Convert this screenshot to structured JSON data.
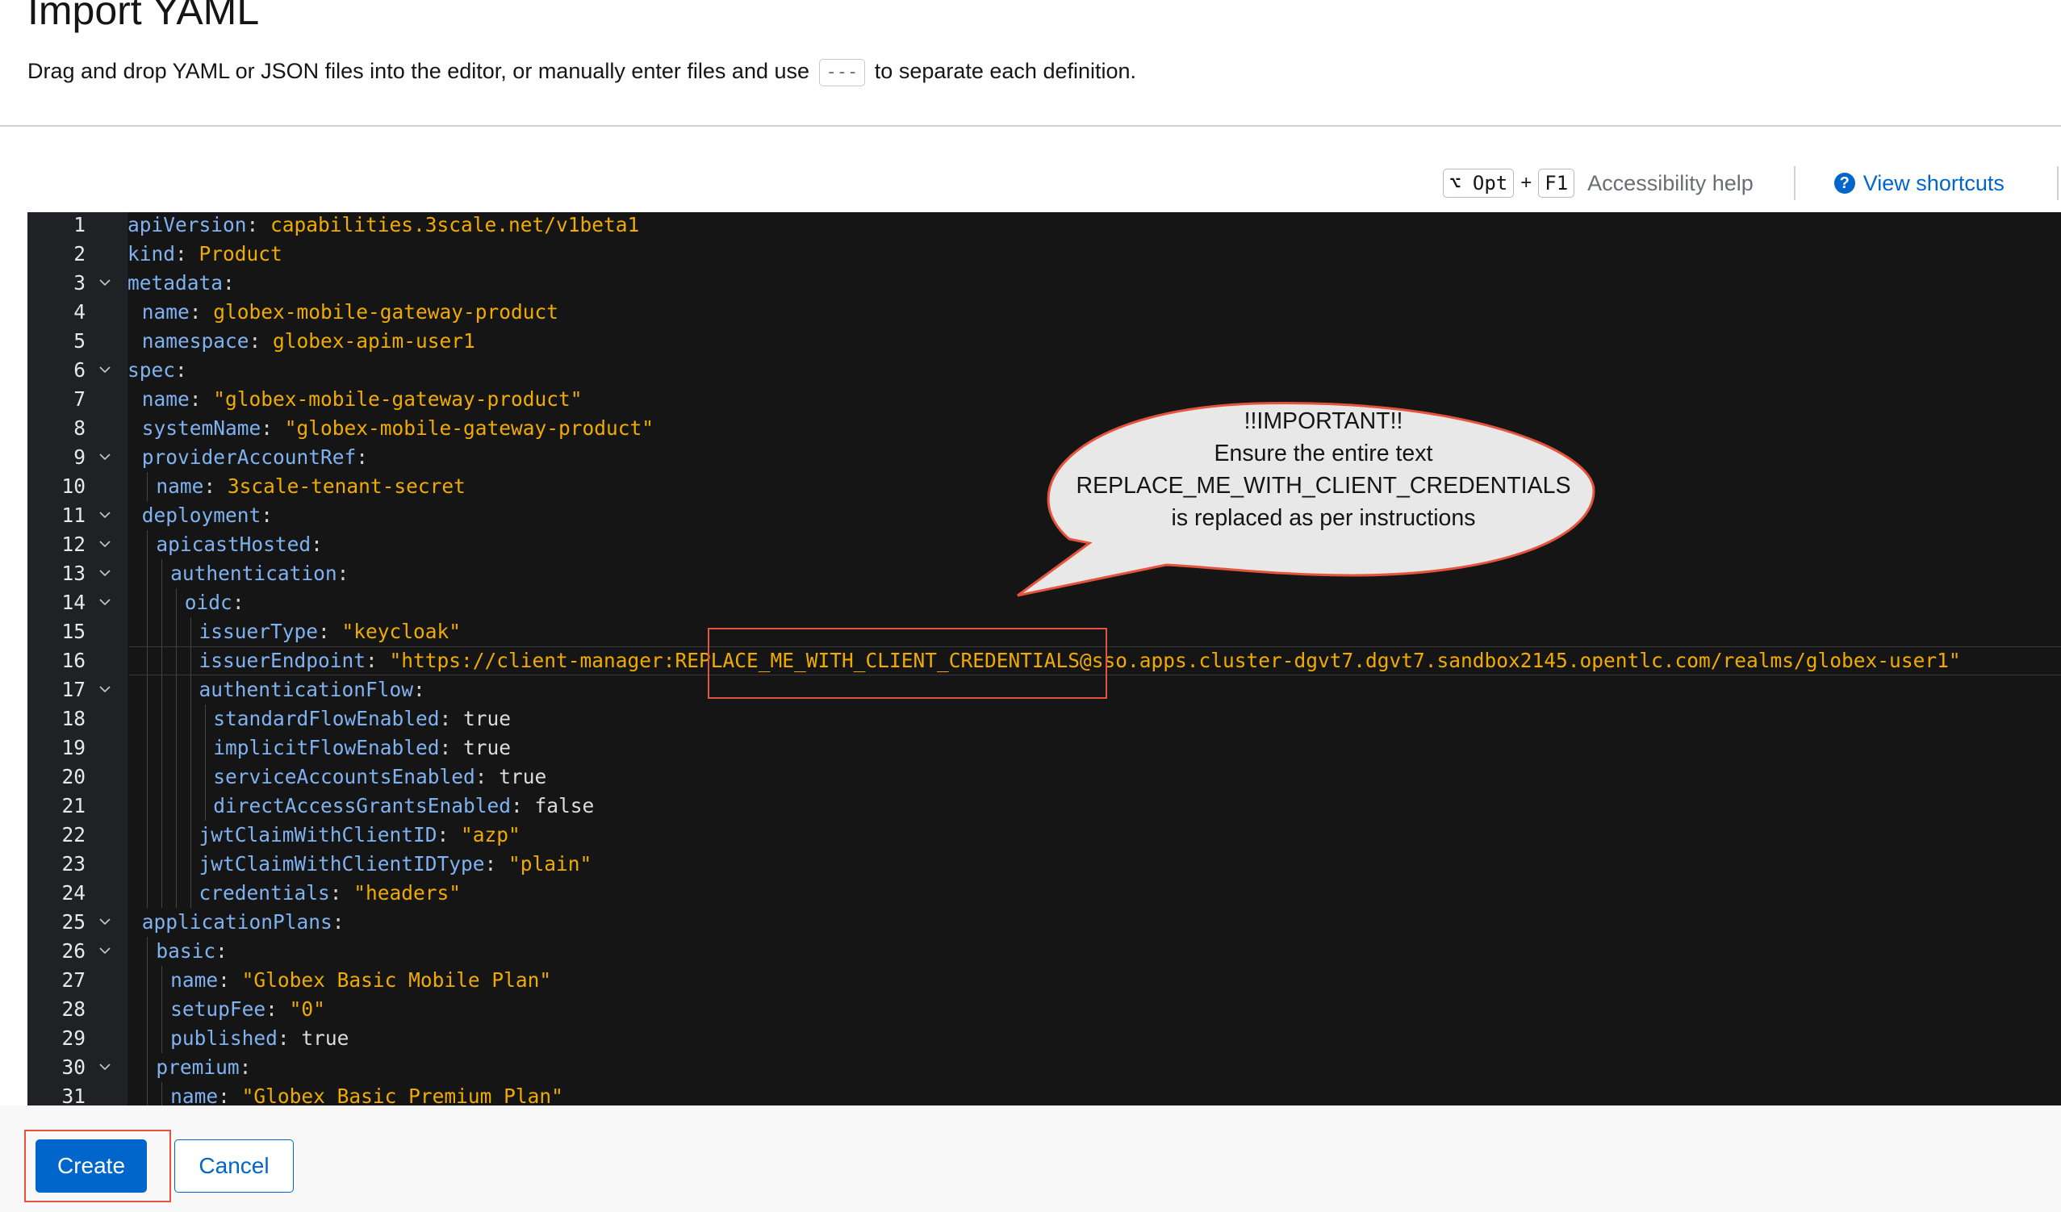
{
  "header": {
    "title": "Import YAML",
    "description_before": "Drag and drop YAML or JSON files into the editor, or manually enter files and use",
    "separator_token": "---",
    "description_after": "to separate each definition."
  },
  "toolbar": {
    "opt_key": "⌥ Opt",
    "plus": "+",
    "f1_key": "F1",
    "accessibility_help": "Accessibility help",
    "view_shortcuts": "View shortcuts",
    "help_icon": "question-circle-icon"
  },
  "editor": {
    "theme": {
      "key_color": "#7fb2f0",
      "value_color": "#f0ab00",
      "background": "#151515"
    },
    "current_line": 16,
    "lines": [
      {
        "n": 1,
        "indent": 0,
        "fold": false,
        "key": "apiVersion",
        "value": "capabilities.3scale.net/v1beta1",
        "vtype": "str"
      },
      {
        "n": 2,
        "indent": 0,
        "fold": false,
        "key": "kind",
        "value": "Product",
        "vtype": "str"
      },
      {
        "n": 3,
        "indent": 0,
        "fold": true,
        "key": "metadata",
        "value": "",
        "vtype": "none"
      },
      {
        "n": 4,
        "indent": 1,
        "fold": false,
        "key": "name",
        "value": "globex-mobile-gateway-product",
        "vtype": "str"
      },
      {
        "n": 5,
        "indent": 1,
        "fold": false,
        "key": "namespace",
        "value": "globex-apim-user1",
        "vtype": "str"
      },
      {
        "n": 6,
        "indent": 0,
        "fold": true,
        "key": "spec",
        "value": "",
        "vtype": "none"
      },
      {
        "n": 7,
        "indent": 1,
        "fold": false,
        "key": "name",
        "value": "\"globex-mobile-gateway-product\"",
        "vtype": "str"
      },
      {
        "n": 8,
        "indent": 1,
        "fold": false,
        "key": "systemName",
        "value": "\"globex-mobile-gateway-product\"",
        "vtype": "str"
      },
      {
        "n": 9,
        "indent": 1,
        "fold": true,
        "key": "providerAccountRef",
        "value": "",
        "vtype": "none"
      },
      {
        "n": 10,
        "indent": 2,
        "fold": false,
        "key": "name",
        "value": "3scale-tenant-secret",
        "vtype": "str"
      },
      {
        "n": 11,
        "indent": 1,
        "fold": true,
        "key": "deployment",
        "value": "",
        "vtype": "none"
      },
      {
        "n": 12,
        "indent": 2,
        "fold": true,
        "key": "apicastHosted",
        "value": "",
        "vtype": "none"
      },
      {
        "n": 13,
        "indent": 3,
        "fold": true,
        "key": "authentication",
        "value": "",
        "vtype": "none"
      },
      {
        "n": 14,
        "indent": 4,
        "fold": true,
        "key": "oidc",
        "value": "",
        "vtype": "none"
      },
      {
        "n": 15,
        "indent": 5,
        "fold": false,
        "key": "issuerType",
        "value": "\"keycloak\"",
        "vtype": "str"
      },
      {
        "n": 16,
        "indent": 5,
        "fold": false,
        "key": "issuerEndpoint",
        "value": "\"https://client-manager:REPLACE_ME_WITH_CLIENT_CREDENTIALS@sso.apps.cluster-dgvt7.dgvt7.sandbox2145.opentlc.com/realms/globex-user1\"",
        "vtype": "str"
      },
      {
        "n": 17,
        "indent": 5,
        "fold": true,
        "key": "authenticationFlow",
        "value": "",
        "vtype": "none"
      },
      {
        "n": 18,
        "indent": 6,
        "fold": false,
        "key": "standardFlowEnabled",
        "value": "true",
        "vtype": "bool"
      },
      {
        "n": 19,
        "indent": 6,
        "fold": false,
        "key": "implicitFlowEnabled",
        "value": "true",
        "vtype": "bool"
      },
      {
        "n": 20,
        "indent": 6,
        "fold": false,
        "key": "serviceAccountsEnabled",
        "value": "true",
        "vtype": "bool"
      },
      {
        "n": 21,
        "indent": 6,
        "fold": false,
        "key": "directAccessGrantsEnabled",
        "value": "false",
        "vtype": "bool"
      },
      {
        "n": 22,
        "indent": 5,
        "fold": false,
        "key": "jwtClaimWithClientID",
        "value": "\"azp\"",
        "vtype": "str"
      },
      {
        "n": 23,
        "indent": 5,
        "fold": false,
        "key": "jwtClaimWithClientIDType",
        "value": "\"plain\"",
        "vtype": "str"
      },
      {
        "n": 24,
        "indent": 5,
        "fold": false,
        "key": "credentials",
        "value": "\"headers\"",
        "vtype": "str"
      },
      {
        "n": 25,
        "indent": 1,
        "fold": true,
        "key": "applicationPlans",
        "value": "",
        "vtype": "none"
      },
      {
        "n": 26,
        "indent": 2,
        "fold": true,
        "key": "basic",
        "value": "",
        "vtype": "none"
      },
      {
        "n": 27,
        "indent": 3,
        "fold": false,
        "key": "name",
        "value": "\"Globex Basic Mobile Plan\"",
        "vtype": "str"
      },
      {
        "n": 28,
        "indent": 3,
        "fold": false,
        "key": "setupFee",
        "value": "\"0\"",
        "vtype": "str"
      },
      {
        "n": 29,
        "indent": 3,
        "fold": false,
        "key": "published",
        "value": "true",
        "vtype": "bool"
      },
      {
        "n": 30,
        "indent": 2,
        "fold": true,
        "key": "premium",
        "value": "",
        "vtype": "none"
      },
      {
        "n": 31,
        "indent": 3,
        "fold": false,
        "key": "name",
        "value": "\"Globex Basic Premium Plan\"",
        "vtype": "str"
      }
    ]
  },
  "callout": {
    "line1": "!!IMPORTANT!!",
    "line2": "Ensure the entire text",
    "line3": "REPLACE_ME_WITH_CLIENT_CREDENTIALS",
    "line4": "is replaced as per instructions",
    "border_color": "#e5533d",
    "fill_color": "#e8e8e8"
  },
  "actions": {
    "create_label": "Create",
    "cancel_label": "Cancel",
    "highlight_color": "#e5533d"
  }
}
